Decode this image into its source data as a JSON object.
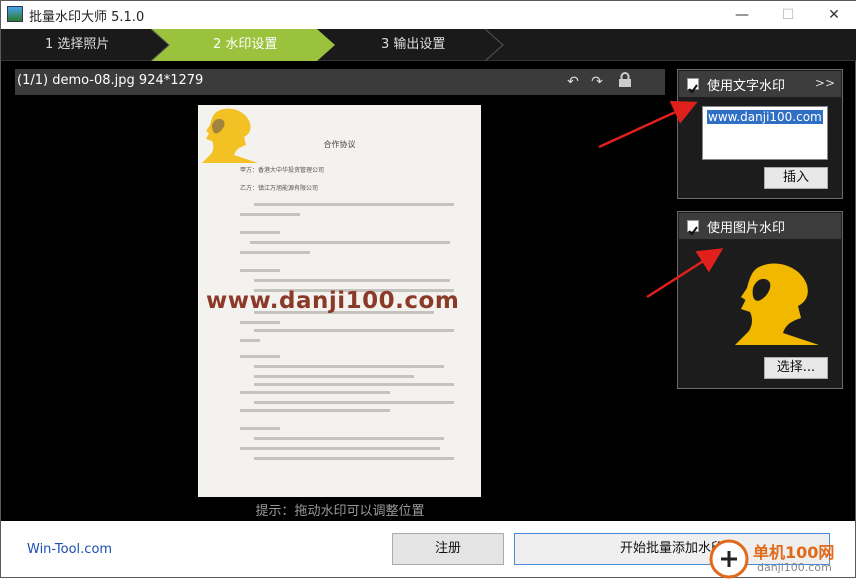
{
  "window": {
    "title": "批量水印大师 5.1.0",
    "controls": {
      "minimize": "—",
      "maximize": "☐",
      "close": "✕"
    }
  },
  "steps": [
    {
      "label": "1 选择照片",
      "active": false
    },
    {
      "label": "2 水印设置",
      "active": true
    },
    {
      "label": "3 输出设置",
      "active": false
    }
  ],
  "preview": {
    "info": "(1/1) demo-08.jpg 924*1279",
    "hint": "提示：拖动水印可以调整位置",
    "document": {
      "title": "合作协议",
      "party_a": "甲方：香港大中华投资管理公司",
      "party_b": "乙方：镇江万旭能源有限公司",
      "watermark_text": "www.danji100.com"
    }
  },
  "text_watermark": {
    "label": "使用文字水印",
    "checked": true,
    "more": ">>",
    "value": "www.danji100.com",
    "insert_button": "插入"
  },
  "image_watermark": {
    "label": "使用图片水印",
    "checked": true,
    "select_button": "选择..."
  },
  "footer": {
    "brand": "Win-Tool.com",
    "register_button": "注册",
    "start_button": "开始批量添加水印"
  },
  "site_badge": {
    "name": "单机100网",
    "url": "danji100.com"
  },
  "colors": {
    "accent_step": "#9ac23c",
    "watermark_gold": "#f2b800",
    "arrow": "#e0201c",
    "selection": "#2f6fc4"
  }
}
